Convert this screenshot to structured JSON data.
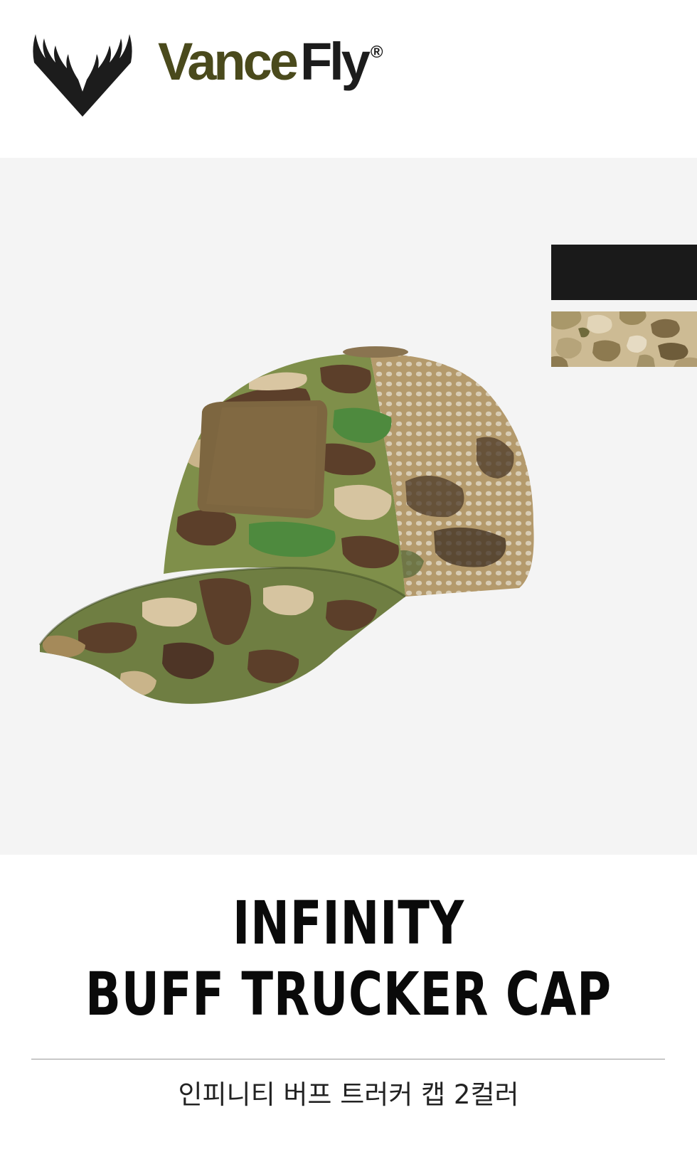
{
  "brand": {
    "name_part1": "Vance",
    "name_part2": "Fly",
    "registered_mark": "®",
    "logo_icon": "wings-v-icon",
    "colors": {
      "olive": "#4a4a1c",
      "dark": "#1c1c1c"
    }
  },
  "product_image": {
    "icon": "camo-trucker-cap-image",
    "background": "#f4f4f4"
  },
  "color_options": [
    {
      "name": "black",
      "color": "#1a1a1a"
    },
    {
      "name": "camo",
      "color": "#c8b48c"
    }
  ],
  "product": {
    "title_line1": "INFINITY",
    "title_line2": "BUFF TRUCKER CAP",
    "subtitle": "인피니티 버프 트러커 캡 2컬러"
  }
}
